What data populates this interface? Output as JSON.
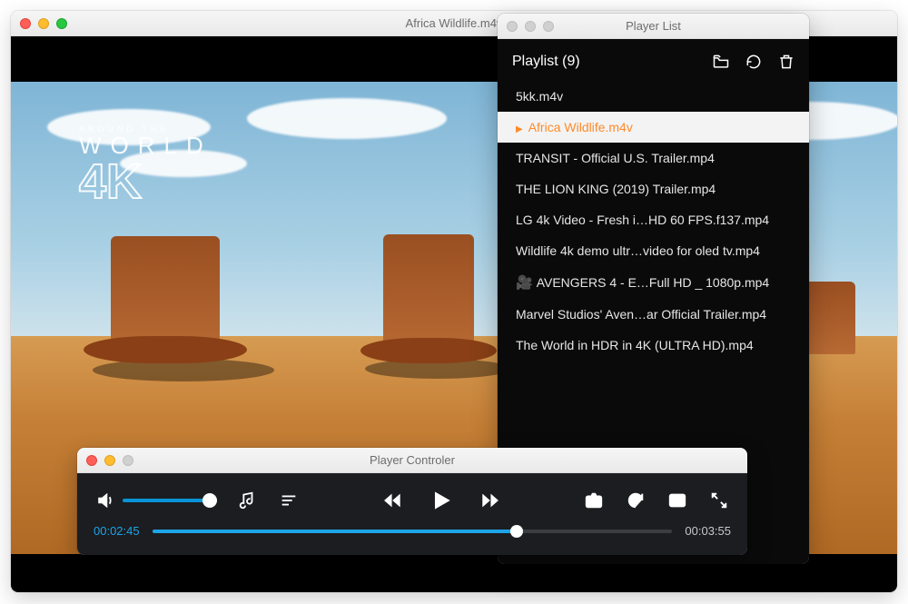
{
  "main": {
    "title": "Africa Wildlife.m4v",
    "watermark": {
      "line1": "AROUND THE",
      "line2": "WORLD",
      "line3": "4K"
    }
  },
  "playlist": {
    "window_title": "Player List",
    "header": "Playlist (9)",
    "items": [
      {
        "label": "5kk.m4v",
        "active": false,
        "icon": ""
      },
      {
        "label": "Africa Wildlife.m4v",
        "active": true,
        "icon": ""
      },
      {
        "label": "TRANSIT - Official U.S. Trailer.mp4",
        "active": false,
        "icon": ""
      },
      {
        "label": "THE LION KING (2019) Trailer.mp4",
        "active": false,
        "icon": ""
      },
      {
        "label": "LG 4k Video - Fresh i…HD 60 FPS.f137.mp4",
        "active": false,
        "icon": ""
      },
      {
        "label": "Wildlife 4k demo ultr…video for oled tv.mp4",
        "active": false,
        "icon": ""
      },
      {
        "label": "AVENGERS 4 - E…Full HD _ 1080p.mp4",
        "active": false,
        "icon": "🎥"
      },
      {
        "label": "Marvel Studios' Aven…ar Official Trailer.mp4",
        "active": false,
        "icon": ""
      },
      {
        "label": "The World in HDR in 4K (ULTRA HD).mp4",
        "active": false,
        "icon": ""
      }
    ]
  },
  "controller": {
    "window_title": "Player Controler",
    "current_time": "00:02:45",
    "duration": "00:03:55",
    "progress_pct": 70,
    "volume_pct": 100
  }
}
